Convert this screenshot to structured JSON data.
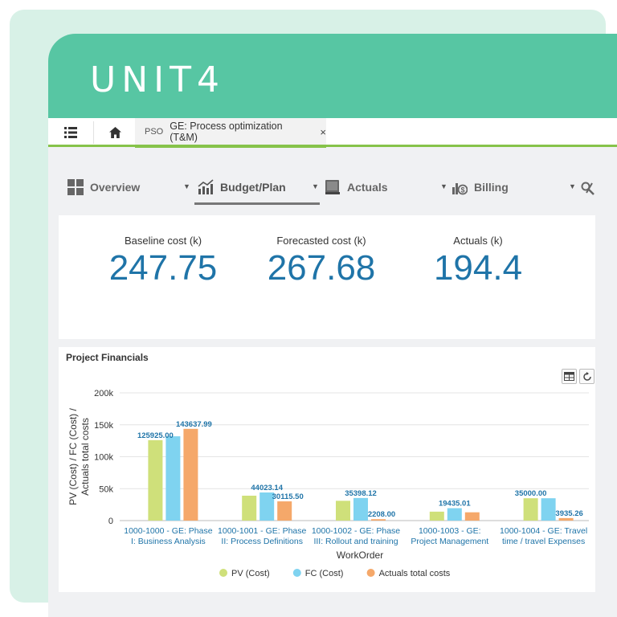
{
  "brand": {
    "logo_text": "UNIT4",
    "bar_color": "#57c6a3"
  },
  "tab_strip": {
    "menu_icon": "list-icon",
    "home_icon": "home-icon",
    "document_tab": {
      "prefix": "PSO",
      "title": "GE: Process optimization (T&M)",
      "close_glyph": "×"
    }
  },
  "nav": {
    "items": [
      {
        "label": "Overview",
        "icon": "grid-icon"
      },
      {
        "label": "Budget/Plan",
        "icon": "chart-trend-icon",
        "active": true
      },
      {
        "label": "Actuals",
        "icon": "book-icon"
      },
      {
        "label": "Billing",
        "icon": "billing-icon"
      }
    ]
  },
  "kpis": [
    {
      "label": "Baseline cost (k)",
      "value": "247.75"
    },
    {
      "label": "Forecasted cost (k)",
      "value": "267.68"
    },
    {
      "label": "Actuals (k)",
      "value": "194.4"
    }
  ],
  "chart_panel": {
    "title": "Project Financials"
  },
  "chart_data": {
    "type": "bar",
    "title": "",
    "xlabel": "WorkOrder",
    "ylabel_line1": "PV (Cost) / FC (Cost) /",
    "ylabel_line2": "Actuals total costs",
    "ylim": [
      0,
      200000
    ],
    "yticks": [
      "0",
      "50k",
      "100k",
      "150k",
      "200k"
    ],
    "grid": true,
    "legend_position": "bottom",
    "categories": [
      [
        "1000-1000 - GE: Phase",
        "I: Business Analysis"
      ],
      [
        "1000-1001 - GE: Phase",
        "II: Process Definitions"
      ],
      [
        "1000-1002 - GE: Phase",
        "III: Rollout and training"
      ],
      [
        "1000-1003 - GE:",
        "Project Management"
      ],
      [
        "1000-1004 - GE: Travel",
        "time / travel Expenses"
      ]
    ],
    "series": [
      {
        "name": "PV (Cost)",
        "color": "#cfe07a",
        "values": [
          125925,
          39000,
          31000,
          14000,
          35000
        ]
      },
      {
        "name": "FC (Cost)",
        "color": "#7fd3f0",
        "values": [
          132000,
          44023.14,
          35398.12,
          19435.01,
          35000
        ]
      },
      {
        "name": "Actuals total costs",
        "color": "#f5a86a",
        "values": [
          143637.99,
          30115.5,
          2208,
          13000,
          3935.26
        ]
      }
    ],
    "data_labels": [
      {
        "category": 0,
        "series": 0,
        "text": "125925.00"
      },
      {
        "category": 0,
        "series": 2,
        "text": "143637.99"
      },
      {
        "category": 1,
        "series": 1,
        "text": "44023.14"
      },
      {
        "category": 1,
        "series": 2,
        "text": "30115.50"
      },
      {
        "category": 2,
        "series": 1,
        "text": "35398.12"
      },
      {
        "category": 2,
        "series": 2,
        "text": "2208.00"
      },
      {
        "category": 3,
        "series": 1,
        "text": "19435.01"
      },
      {
        "category": 4,
        "series": 0,
        "text": "35000.00"
      },
      {
        "category": 4,
        "series": 2,
        "text": "3935.26"
      }
    ]
  }
}
